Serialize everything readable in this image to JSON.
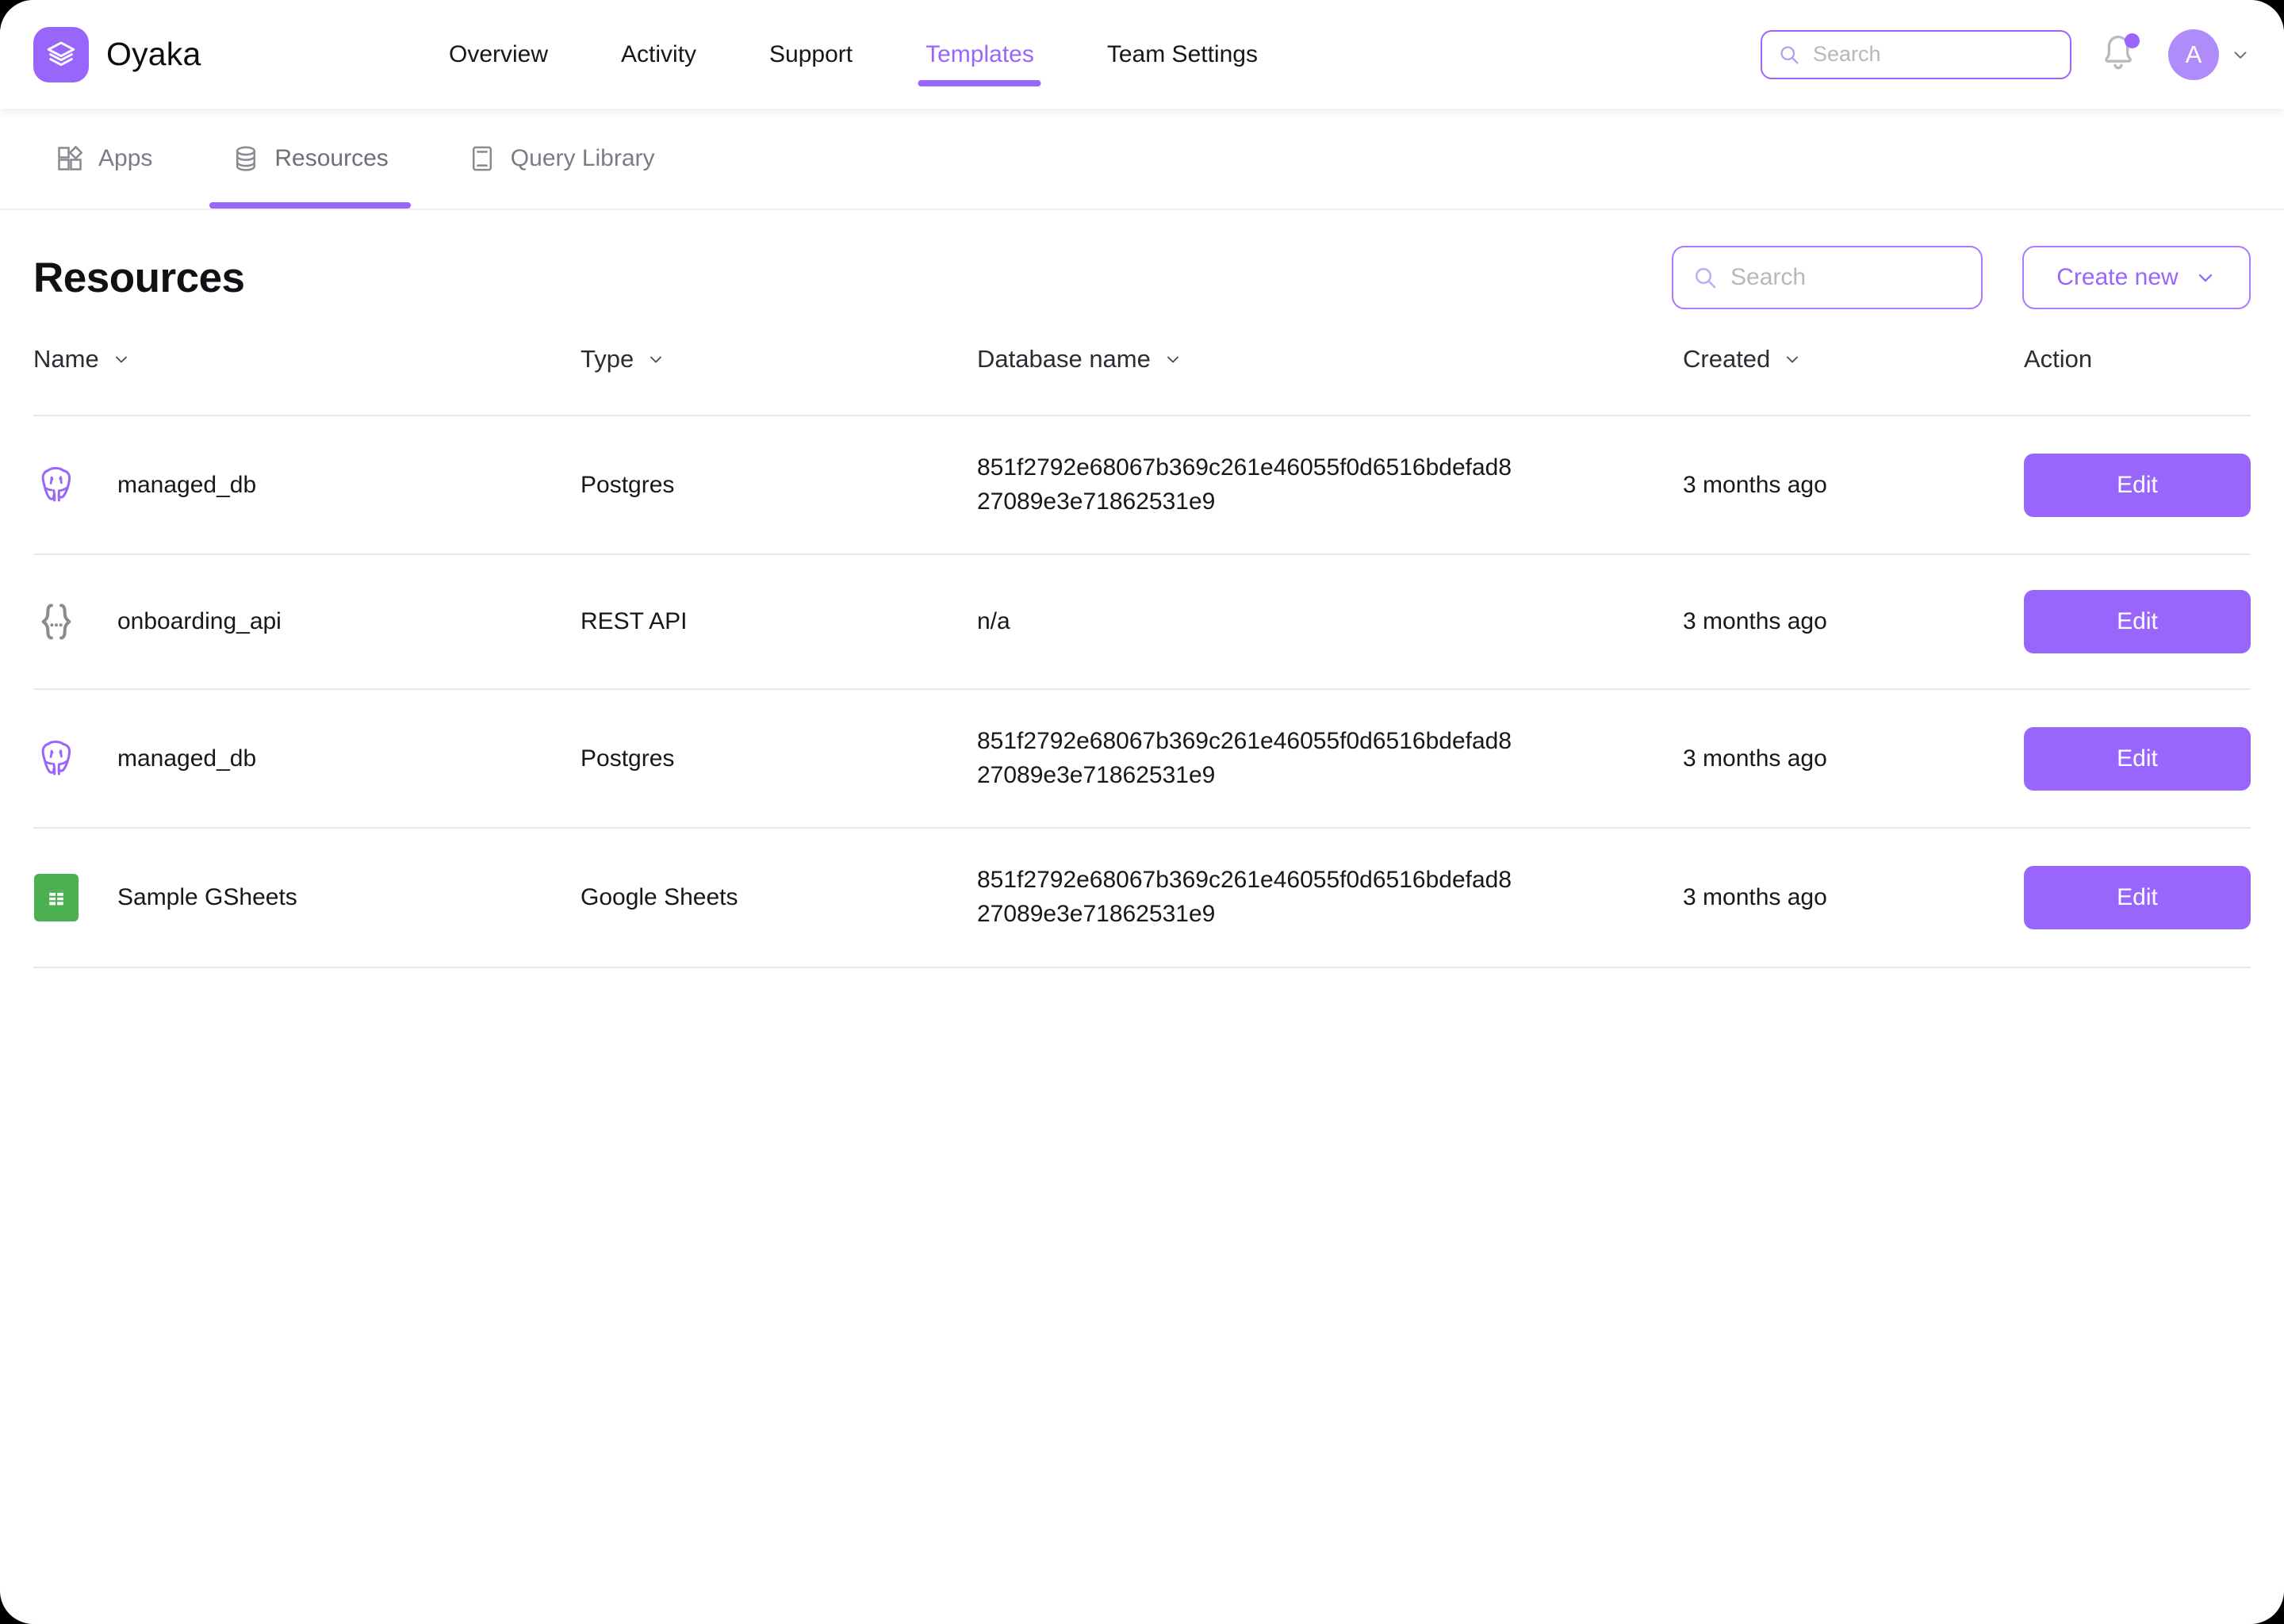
{
  "brand": {
    "name": "Oyaka",
    "logo_icon": "layers-stack-icon",
    "logo_color": "#9966fb"
  },
  "header": {
    "nav": [
      {
        "label": "Overview",
        "active": false
      },
      {
        "label": "Activity",
        "active": false
      },
      {
        "label": "Support",
        "active": false
      },
      {
        "label": "Templates",
        "active": true
      },
      {
        "label": "Team Settings",
        "active": false
      }
    ],
    "search": {
      "placeholder": "Search",
      "value": "",
      "icon": "search-icon"
    },
    "notifications": {
      "icon": "bell-icon",
      "has_unread_dot": true,
      "dot_color": "#9966fb"
    },
    "account": {
      "initial": "A",
      "avatar_color": "#b08cfb",
      "chevron": "chevron-down-icon"
    }
  },
  "subnav": {
    "tabs": [
      {
        "label": "Apps",
        "icon": "apps-grid-icon",
        "active": false
      },
      {
        "label": "Resources",
        "icon": "database-icon",
        "active": true
      },
      {
        "label": "Query Library",
        "icon": "book-icon",
        "active": false
      }
    ]
  },
  "main": {
    "title": "Resources",
    "search": {
      "placeholder": "Search",
      "value": "",
      "icon": "search-icon"
    },
    "create_button": {
      "label": "Create new",
      "icon": "chevron-down-icon"
    },
    "table": {
      "columns": [
        {
          "label": "Name",
          "sortable": true
        },
        {
          "label": "Type",
          "sortable": true
        },
        {
          "label": "Database name",
          "sortable": true
        },
        {
          "label": "Created",
          "sortable": true
        },
        {
          "label": "Action",
          "sortable": false
        }
      ],
      "rows": [
        {
          "icon": "postgres-elephant-icon",
          "icon_color": "#9966fb",
          "name": "managed_db",
          "type": "Postgres",
          "database_name": "851f2792e68067b369c261e46055f0d6516bdefad827089e3e71862531e9",
          "created": "3 months ago",
          "action_label": "Edit"
        },
        {
          "icon": "curly-braces-icon",
          "icon_color": "#8a8a92",
          "name": "onboarding_api",
          "type": "REST API",
          "database_name": "n/a",
          "created": "3 months ago",
          "action_label": "Edit"
        },
        {
          "icon": "postgres-elephant-icon",
          "icon_color": "#9966fb",
          "name": "managed_db",
          "type": "Postgres",
          "database_name": "851f2792e68067b369c261e46055f0d6516bdefad827089e3e71862531e9",
          "created": "3 months ago",
          "action_label": "Edit"
        },
        {
          "icon": "google-sheets-icon",
          "icon_color": "#4caf50",
          "name": "Sample GSheets",
          "type": "Google Sheets",
          "database_name": "851f2792e68067b369c261e46055f0d6516bdefad827089e3e71862531e9",
          "created": "3 months ago",
          "action_label": "Edit"
        }
      ]
    }
  },
  "theme": {
    "accent": "#9966fb",
    "accent_light": "#b08cfb",
    "green": "#4caf50",
    "text": "#17171d",
    "muted": "#7b7b85",
    "border": "#e9e9ed"
  }
}
